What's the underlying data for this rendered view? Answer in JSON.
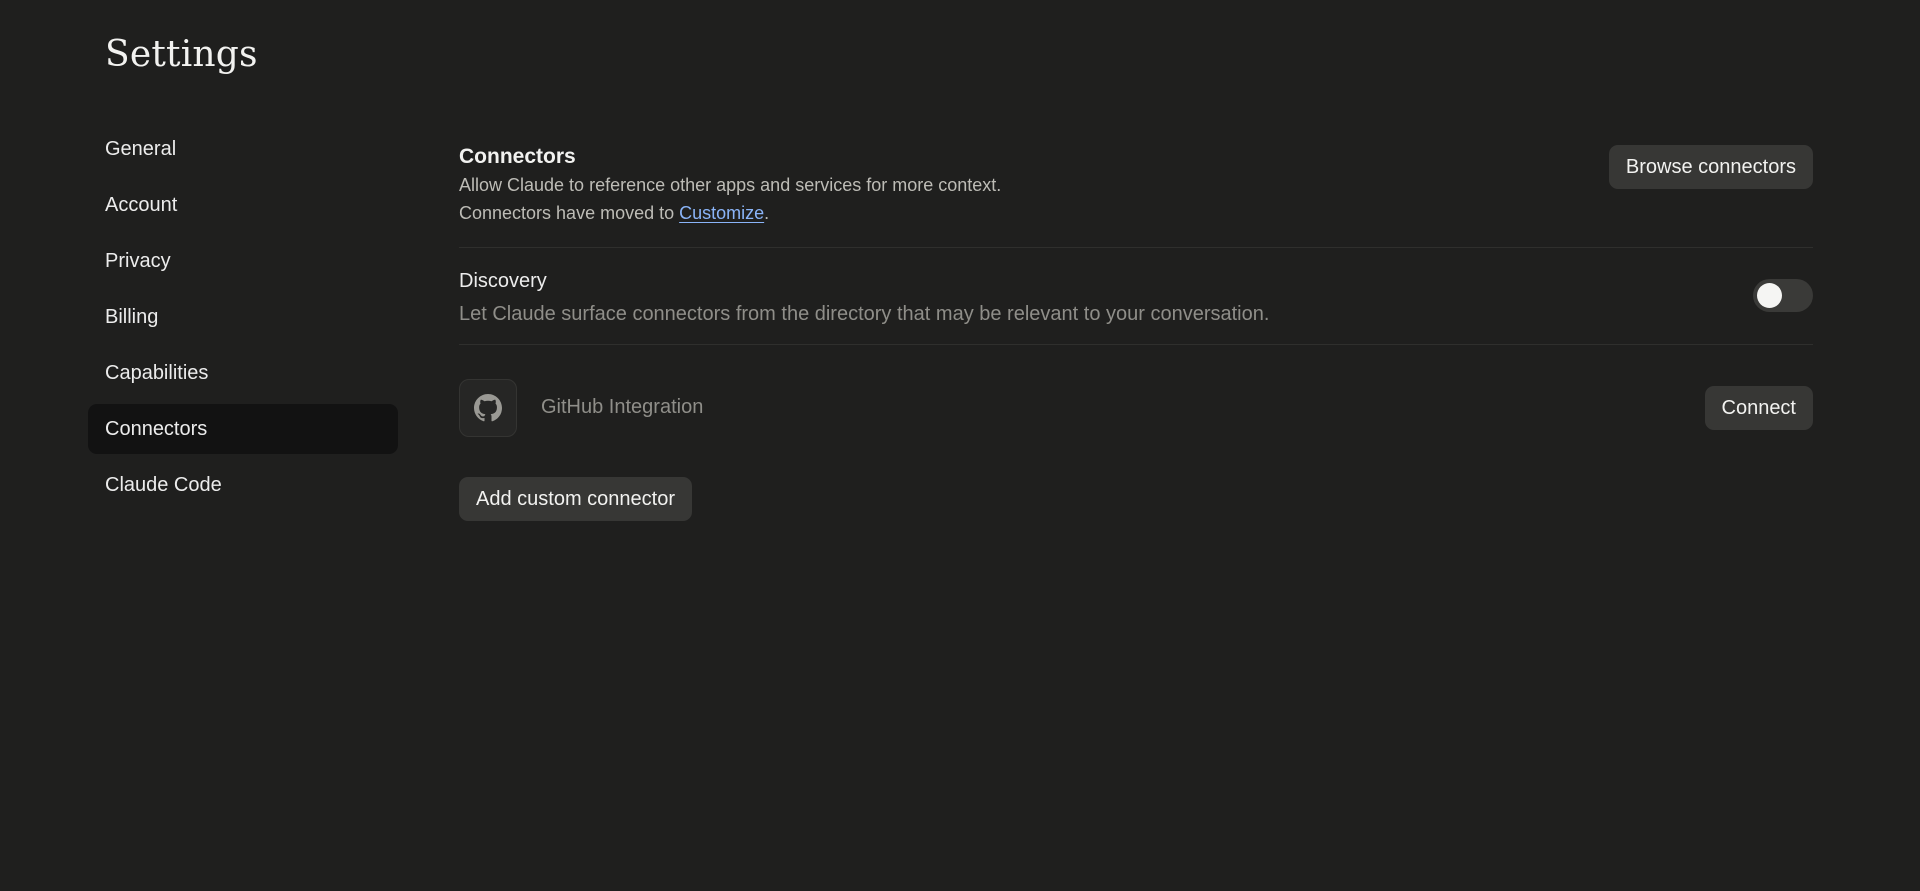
{
  "header": {
    "title": "Settings"
  },
  "sidebar": {
    "items": [
      {
        "label": "General"
      },
      {
        "label": "Account"
      },
      {
        "label": "Privacy"
      },
      {
        "label": "Billing"
      },
      {
        "label": "Capabilities"
      },
      {
        "label": "Connectors",
        "active": true
      },
      {
        "label": "Claude Code"
      }
    ]
  },
  "connectors": {
    "title": "Connectors",
    "description": "Allow Claude to reference other apps and services for more context.",
    "moved_prefix": "Connectors have moved to ",
    "moved_link": "Customize",
    "moved_suffix": ".",
    "browse_label": "Browse connectors"
  },
  "discovery": {
    "title": "Discovery",
    "description": "Let Claude surface connectors from the directory that may be relevant to your conversation.",
    "enabled": false
  },
  "integrations": [
    {
      "name": "GitHub Integration",
      "icon": "github-icon",
      "action_label": "Connect"
    }
  ],
  "add_custom_label": "Add custom connector",
  "colors": {
    "background": "#1f1f1e",
    "active_nav": "#121212",
    "button": "#373735",
    "link": "#8ab4f8"
  }
}
